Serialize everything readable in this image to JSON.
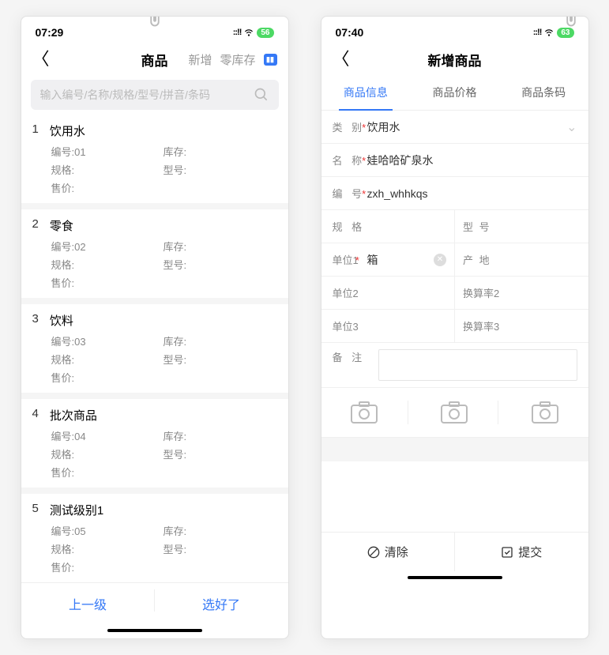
{
  "left": {
    "status": {
      "time": "07:29",
      "battery": "56"
    },
    "header": {
      "title": "商品",
      "action_add": "新增",
      "action_zero": "零库存"
    },
    "search": {
      "placeholder": "输入编号/名称/规格/型号/拼音/条码"
    },
    "labels": {
      "code": "编号:",
      "stock": "库存:",
      "spec": "规格:",
      "model": "型号:",
      "price": "售价:"
    },
    "items": [
      {
        "idx": "1",
        "name": "饮用水",
        "code": "01"
      },
      {
        "idx": "2",
        "name": "零食",
        "code": "02"
      },
      {
        "idx": "3",
        "name": "饮料",
        "code": "03"
      },
      {
        "idx": "4",
        "name": "批次商品",
        "code": "04"
      },
      {
        "idx": "5",
        "name": "测试级别1",
        "code": "05"
      }
    ],
    "footer": {
      "prev": "上一级",
      "done": "选好了"
    }
  },
  "right": {
    "status": {
      "time": "07:40",
      "battery": "63"
    },
    "header": {
      "title": "新增商品"
    },
    "tabs": [
      "商品信息",
      "商品价格",
      "商品条码"
    ],
    "form": {
      "category_label": "类 别",
      "category_value": "饮用水",
      "name_label": "名 称",
      "name_value": "娃哈哈矿泉水",
      "code_label": "编 号",
      "code_value": "zxh_whhkqs",
      "spec_label": "规 格",
      "model_label": "型 号",
      "unit1_label": "单位1",
      "unit1_value": "箱",
      "origin_label": "产 地",
      "unit2_label": "单位2",
      "rate2_label": "换算率2",
      "unit3_label": "单位3",
      "rate3_label": "换算率3",
      "remark_label": "备 注"
    },
    "footer": {
      "clear": "清除",
      "submit": "提交"
    }
  }
}
